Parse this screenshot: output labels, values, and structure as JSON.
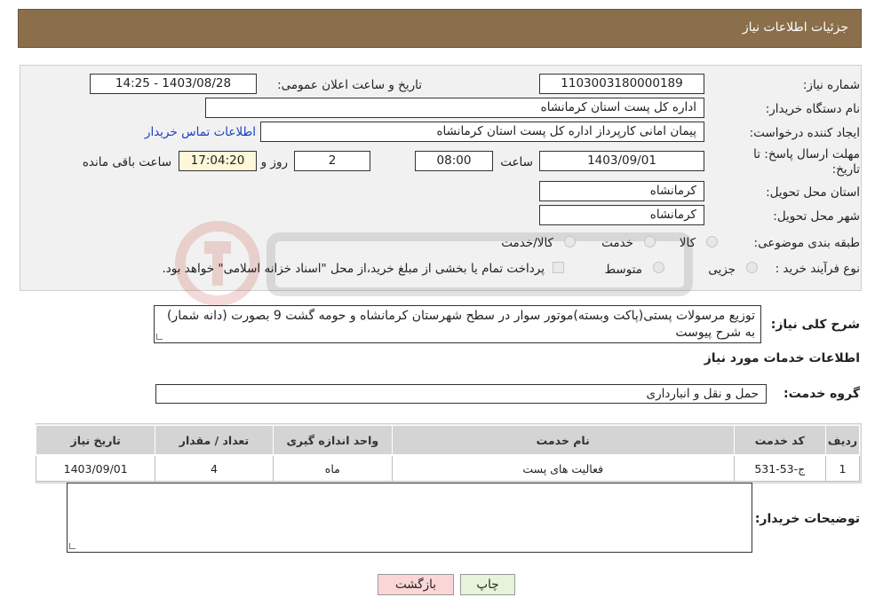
{
  "header": {
    "title": "جزئیات اطلاعات نیاز"
  },
  "fields": {
    "need_number_label": "شماره نیاز:",
    "need_number": "1103003180000189",
    "announce_datetime_label": "تاریخ و ساعت اعلان عمومی:",
    "announce_datetime": "1403/08/28 - 14:25",
    "buyer_org_label": "نام دستگاه خریدار:",
    "buyer_org": "اداره کل پست استان کرمانشاه",
    "requester_label": "ایجاد کننده درخواست:",
    "requester": "پیمان امانی کارپرداز اداره کل پست استان کرمانشاه",
    "buyer_contact_link": "اطلاعات تماس خریدار",
    "deadline_label": "مهلت ارسال پاسخ: تا تاریخ:",
    "deadline_date": "1403/09/01",
    "time_label": "ساعت",
    "deadline_time": "08:00",
    "days_value": "2",
    "days_label": "روز و",
    "remaining_time": "17:04:20",
    "remaining_label": "ساعت باقی مانده",
    "province_label": "استان محل تحویل:",
    "province": "کرمانشاه",
    "city_label": "شهر محل تحویل:",
    "city": "کرمانشاه",
    "category_label": "طبقه بندی موضوعی:",
    "category_options": [
      "کالا",
      "خدمت",
      "کالا/خدمت"
    ],
    "purchase_type_label": "نوع فرآیند خرید :",
    "purchase_options": [
      "جزیی",
      "متوسط"
    ],
    "payment_note": "پرداخت تمام یا بخشی از مبلغ خرید،از محل \"اسناد خزانه اسلامی\" خواهد بود."
  },
  "description": {
    "label": "شرح کلی نیاز:",
    "text": "توزیع مرسولات پستی(پاکت وبسته)موتور سوار در سطح شهرستان کرمانشاه و حومه گشت 9 بصورت (دانه شمار) به شرح پیوست"
  },
  "services_section": {
    "title": "اطلاعات خدمات مورد نیاز",
    "group_label": "گروه خدمت:",
    "group_value": "حمل و نقل و انبارداری"
  },
  "table": {
    "headers": [
      "ردیف",
      "کد خدمت",
      "نام خدمت",
      "واحد اندازه گیری",
      "تعداد / مقدار",
      "تاریخ نیاز"
    ],
    "rows": [
      [
        "1",
        "ج-53-531",
        "فعالیت های پست",
        "ماه",
        "4",
        "1403/09/01"
      ]
    ]
  },
  "buyer_notes": {
    "label": "توضیحات خریدار:",
    "text": ""
  },
  "buttons": {
    "print": "چاپ",
    "back": "بازگشت"
  },
  "colors": {
    "header_bg": "#8a6f4a",
    "link": "#1a40c8",
    "remaining_bg": "#fff7d9",
    "back_bg": "#fbd6d6",
    "print_bg": "#e6f5d9"
  }
}
